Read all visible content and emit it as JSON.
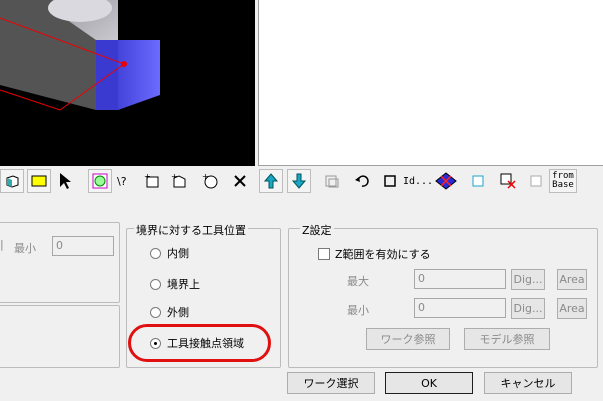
{
  "boundary_group": {
    "title": "境界に対する工具位置",
    "options": [
      {
        "label": "内側",
        "checked": false
      },
      {
        "label": "境界上",
        "checked": false
      },
      {
        "label": "外側",
        "checked": false
      },
      {
        "label": "工具接触点領域",
        "checked": true
      }
    ]
  },
  "left_panel": {
    "min_label": "最小",
    "min_value": "0"
  },
  "z_group": {
    "title": "Z設定",
    "enable_label": "Z範囲を有効にする",
    "max_label": "最大",
    "max_value": "0",
    "min_label": "最小",
    "min_value": "0",
    "dig_label": "Dig...",
    "area_label": "Area",
    "work_ref_label": "ワーク参照",
    "model_ref_label": "モデル参照"
  },
  "buttons": {
    "work_select": "ワーク選択",
    "ok": "OK",
    "cancel": "キャンセル"
  },
  "toolbar": {
    "id_label": "Id...",
    "from_base_line1": "from",
    "from_base_line2": "Base"
  },
  "colors": {
    "highlight": "#e01010",
    "accent_blue": "#2b2bd6",
    "arrow_teal": "#1aa6c8"
  }
}
